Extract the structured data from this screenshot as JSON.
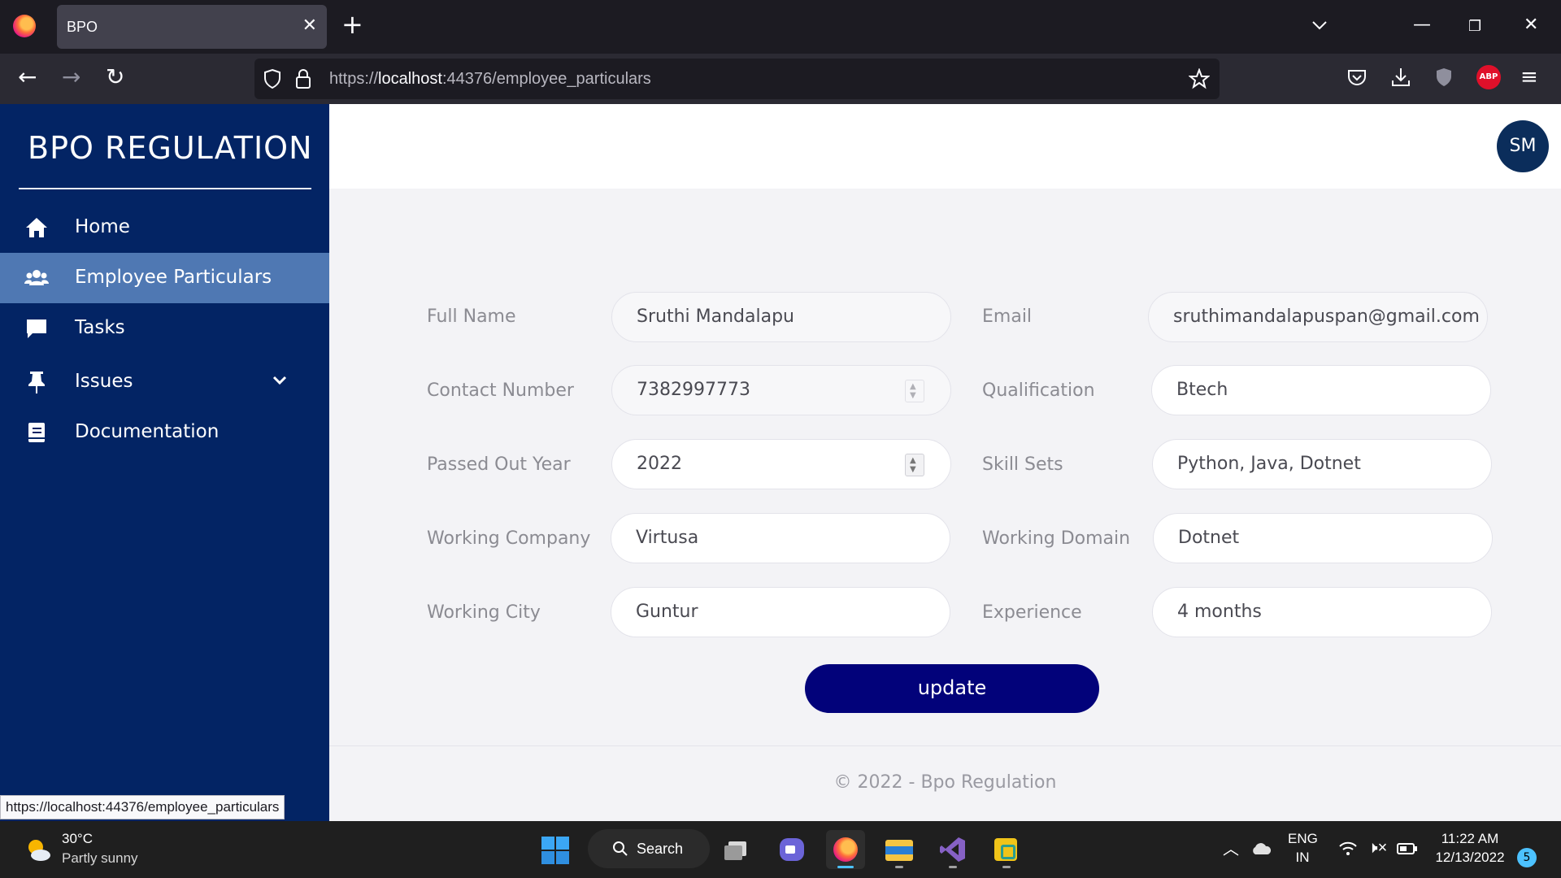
{
  "browser": {
    "tab_title": "BPO",
    "url_prefix": "https://",
    "url_host": "localhost",
    "url_rest": ":44376/employee_particulars",
    "status_url": "https://localhost:44376/employee_particulars"
  },
  "sidebar": {
    "brand": "BPO REGULATION",
    "items": [
      {
        "label": "Home",
        "icon": "home-icon"
      },
      {
        "label": "Employee Particulars",
        "icon": "users-icon",
        "active": true
      },
      {
        "label": "Tasks",
        "icon": "comment-icon"
      },
      {
        "label": "Issues",
        "icon": "pin-icon",
        "has_dropdown": true
      },
      {
        "label": "Documentation",
        "icon": "book-icon"
      }
    ]
  },
  "header": {
    "avatar_initials": "SM"
  },
  "form": {
    "full_name": {
      "label": "Full Name",
      "value": "Sruthi Mandalapu"
    },
    "email": {
      "label": "Email",
      "value": "sruthimandalapuspan@gmail.com"
    },
    "contact": {
      "label": "Contact Number",
      "value": "7382997773"
    },
    "qualification": {
      "label": "Qualification",
      "value": "Btech"
    },
    "passed_year": {
      "label": "Passed Out Year",
      "value": "2022"
    },
    "skills": {
      "label": "Skill Sets",
      "value": "Python, Java, Dotnet"
    },
    "company": {
      "label": "Working Company",
      "value": "Virtusa"
    },
    "domain": {
      "label": "Working Domain",
      "value": "Dotnet"
    },
    "city": {
      "label": "Working City",
      "value": "Guntur"
    },
    "experience": {
      "label": "Experience",
      "value": "4 months"
    },
    "submit_label": "update"
  },
  "footer": {
    "text": "© 2022 - Bpo Regulation"
  },
  "taskbar": {
    "weather_temp": "30°C",
    "weather_desc": "Partly sunny",
    "search_label": "Search",
    "lang_top": "ENG",
    "lang_bottom": "IN",
    "time": "11:22 AM",
    "date": "12/13/2022",
    "notification_count": "5"
  },
  "colors": {
    "sidebar_bg": "#032464",
    "sidebar_active": "#4f78b3",
    "button_bg": "#02027a",
    "avatar_bg": "#0b2d5b"
  }
}
